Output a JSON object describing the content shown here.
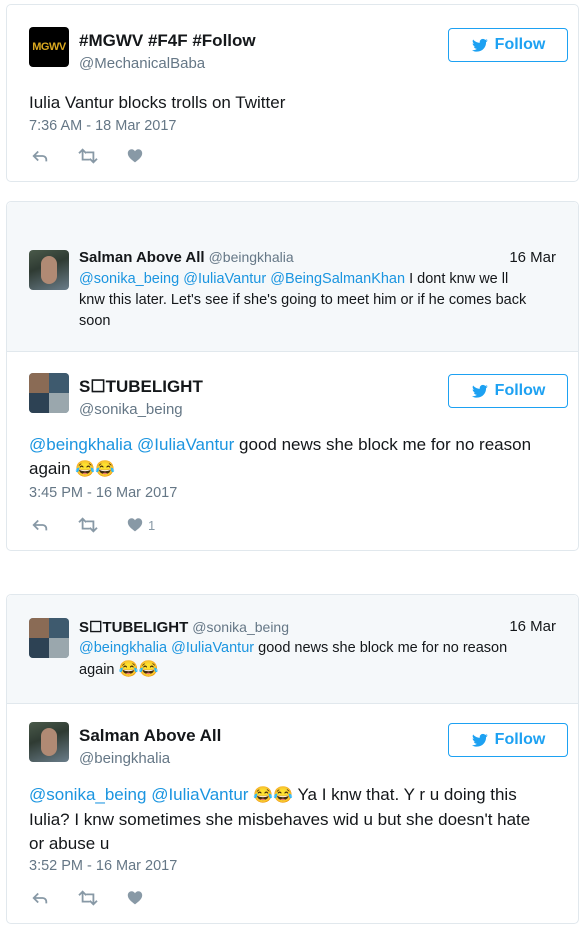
{
  "tweet1": {
    "name": "#MGWV #F4F #Follow",
    "handle": "@MechanicalBaba",
    "avatar_text": "MGWV",
    "follow_label": "Follow",
    "text": "Iulia Vantur blocks trolls on Twitter",
    "timestamp": "7:36 AM - 18 Mar 2017",
    "like_count": ""
  },
  "thread2": {
    "parent": {
      "name": "Salman Above All",
      "handle": "@beingkhalia",
      "date": "16 Mar",
      "mentions": [
        "@sonika_being",
        "@IuliaVantur",
        "@BeingSalmanKhan"
      ],
      "text_line1": "I dont knw we ll",
      "text_line2": "knw this later. Let's see if she's going to meet him or if he comes back",
      "text_line3": "soon"
    },
    "tweet": {
      "name": "S☐TUBELIGHT",
      "handle": "@sonika_being",
      "follow_label": "Follow",
      "mentions": [
        "@beingkhalia",
        "@IuliaVantur"
      ],
      "text_line1": "good news she block me for no reason",
      "text_line2": "again",
      "emoji": "😂😂",
      "timestamp": "3:45 PM - 16 Mar 2017",
      "like_count": "1"
    }
  },
  "thread3": {
    "parent": {
      "name": "S☐TUBELIGHT",
      "handle": "@sonika_being",
      "date": "16 Mar",
      "mentions": [
        "@beingkhalia",
        "@IuliaVantur"
      ],
      "text_line1": "good news she block me for no reason",
      "text_line2": "again",
      "emoji": "😂😂"
    },
    "tweet": {
      "name": "Salman Above All",
      "handle": "@beingkhalia",
      "follow_label": "Follow",
      "mentions": [
        "@sonika_being",
        "@IuliaVantur"
      ],
      "emoji": "😂😂",
      "text_line1": "Ya I knw that. Y r u doing this",
      "text_line2": "Iulia? I knw sometimes she misbehaves wid u but she doesn't hate",
      "text_line3": "or abuse u",
      "timestamp": "3:52 PM - 16 Mar 2017",
      "like_count": ""
    }
  },
  "colors": {
    "link": "#1b95e0",
    "follow_border": "#1da1f2",
    "muted": "#657786",
    "icon": "#8899a6",
    "parent_bg": "#f5f8fa"
  },
  "icons": [
    "twitter-bird-icon",
    "reply-icon",
    "retweet-icon",
    "heart-icon"
  ]
}
